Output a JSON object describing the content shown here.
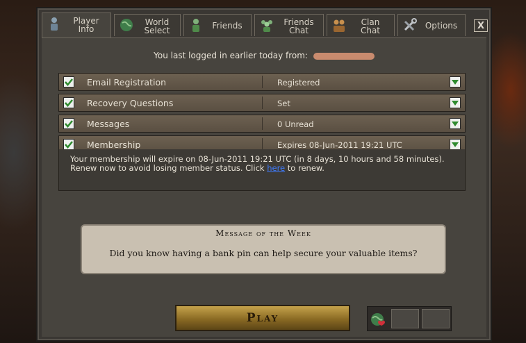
{
  "tabs": [
    {
      "label": "Player\nInfo",
      "icon": "player-icon",
      "active": true
    },
    {
      "label": "World\nSelect",
      "icon": "globe-icon",
      "active": false
    },
    {
      "label": "Friends",
      "icon": "friends-icon",
      "active": false
    },
    {
      "label": "Friends\nChat",
      "icon": "friends-chat-icon",
      "active": false
    },
    {
      "label": "Clan\nChat",
      "icon": "clan-chat-icon",
      "active": false
    },
    {
      "label": "Options",
      "icon": "tools-icon",
      "active": false
    }
  ],
  "close_label": "X",
  "last_login_text": "You last logged in earlier today from:",
  "rows": [
    {
      "label": "Email Registration",
      "value": "Registered"
    },
    {
      "label": "Recovery Questions",
      "value": "Set"
    },
    {
      "label": "Messages",
      "value": "0 Unread"
    },
    {
      "label": "Membership",
      "value": "Expires 08-Jun-2011 19:21 UTC"
    }
  ],
  "membership_info": {
    "text_before": "Your membership will expire on 08-Jun-2011 19:21 UTC (in 8 days, 10 hours and 58 minutes). Renew now to avoid losing member status. Click ",
    "link": "here",
    "text_after": " to renew."
  },
  "message_of_the_week": {
    "title": "Message of the Week",
    "text": "Did you know having a bank pin can help secure your valuable items?"
  },
  "play_label": "Play",
  "colors": {
    "check_green": "#2e8a2e",
    "play_gold": "#c5a24b",
    "link_blue": "#3f7cff"
  }
}
